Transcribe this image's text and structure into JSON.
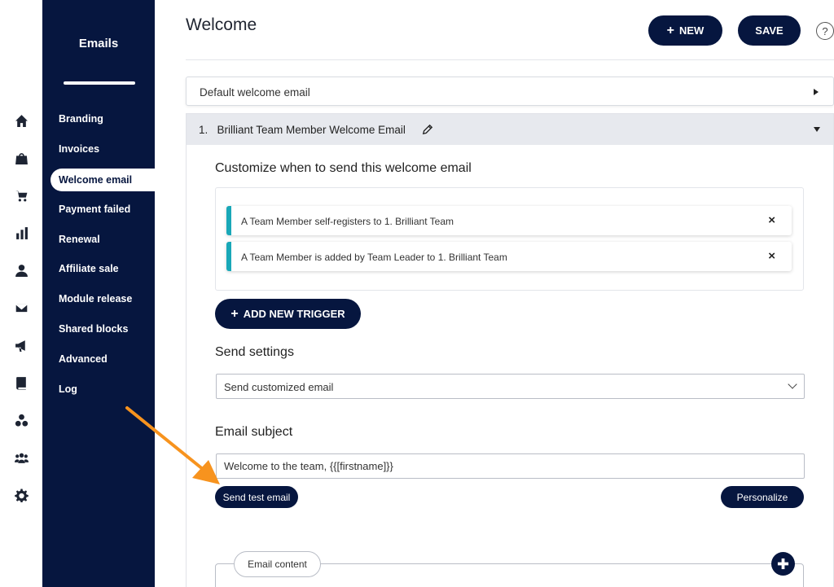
{
  "rail": {
    "icons": [
      "home-icon",
      "store-icon",
      "cart-icon",
      "bar-chart-icon",
      "user-icon",
      "mail-icon",
      "megaphone-icon",
      "book-icon",
      "circles-icon",
      "group-icon",
      "gear-icon"
    ]
  },
  "sidebar": {
    "title": "Emails",
    "items": [
      {
        "label": "Branding"
      },
      {
        "label": "Invoices"
      },
      {
        "label": "Welcome email",
        "active": true
      },
      {
        "label": "Payment failed"
      },
      {
        "label": "Renewal"
      },
      {
        "label": "Affiliate sale"
      },
      {
        "label": "Module release"
      },
      {
        "label": "Shared blocks"
      },
      {
        "label": "Advanced"
      },
      {
        "label": "Log"
      }
    ]
  },
  "header": {
    "title": "Welcome",
    "new_label": "NEW",
    "save_label": "SAVE",
    "help": "?"
  },
  "accordions": {
    "default": "Default welcome email",
    "team": "1.   Brilliant Team Member Welcome Email"
  },
  "triggers": {
    "heading": "Customize when to send this welcome email",
    "items": [
      "A Team Member self-registers to 1. Brilliant Team",
      "A Team Member is added by Team Leader to 1. Brilliant Team"
    ],
    "remove_glyph": "×",
    "add_label": "ADD NEW TRIGGER"
  },
  "send_settings": {
    "heading": "Send settings",
    "value": "Send customized email"
  },
  "subject": {
    "heading": "Email subject",
    "value": "Welcome to the team, {{[firstname]}}",
    "test_label": "Send test email",
    "personalize_label": "Personalize"
  },
  "content": {
    "label": "Email content"
  },
  "colors": {
    "navy": "#06163f",
    "accent_teal": "#19a8b8",
    "arrow": "#f7931e"
  }
}
